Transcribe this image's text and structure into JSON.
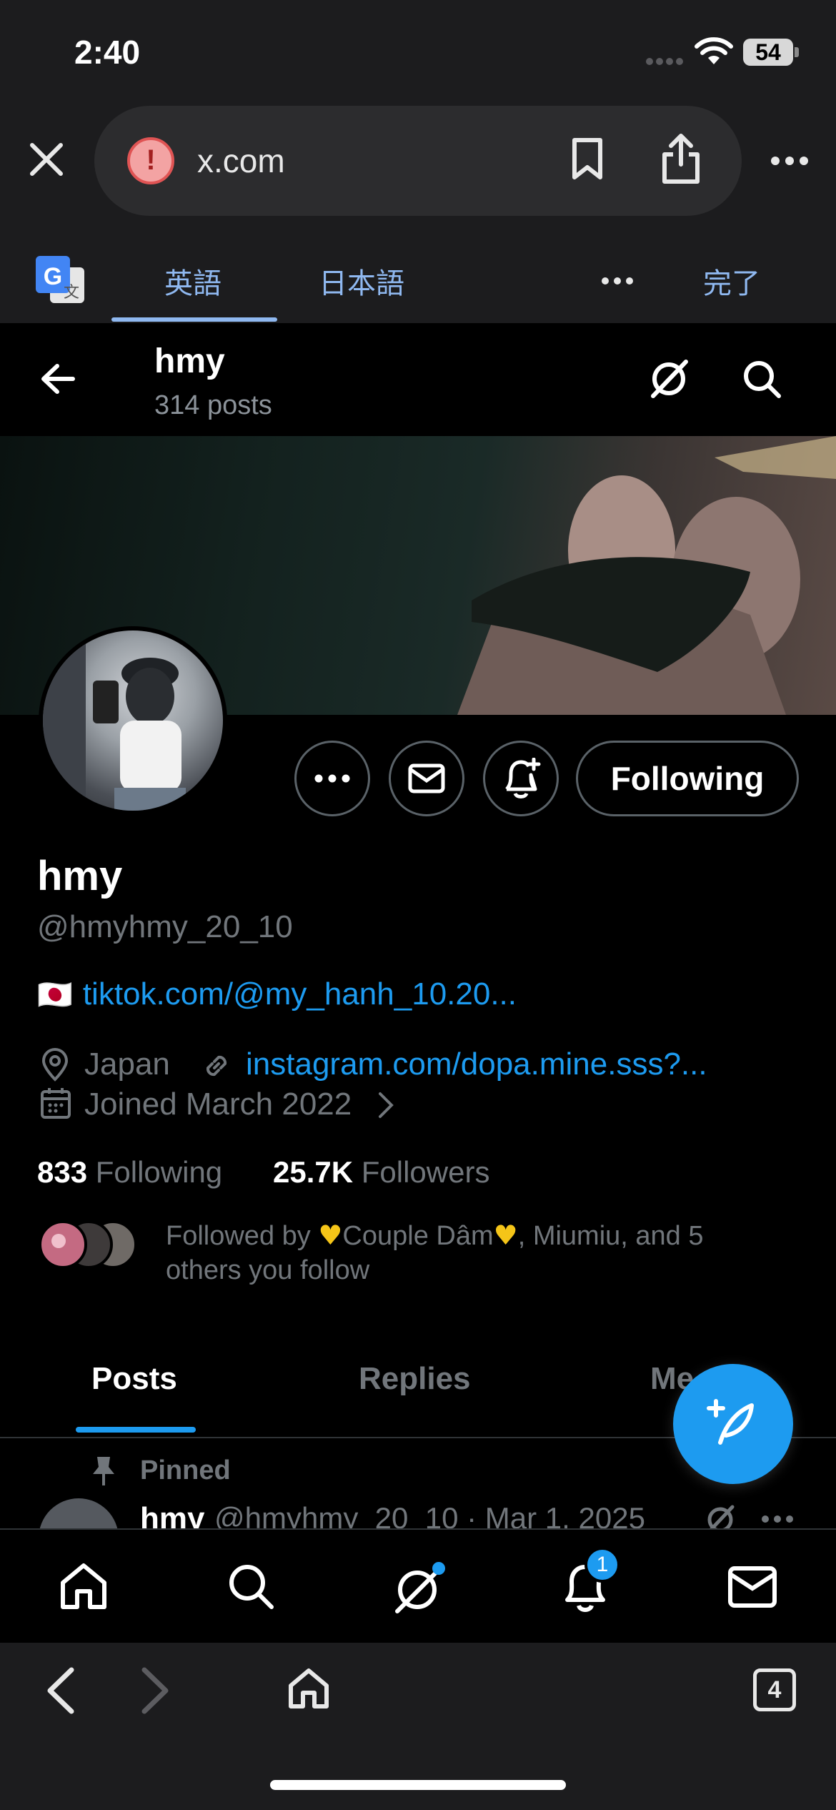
{
  "status_bar": {
    "time": "2:40",
    "battery": "54"
  },
  "browser": {
    "url": "x.com"
  },
  "translate_bar": {
    "lang_source": "英語",
    "lang_target": "日本語",
    "done": "完了"
  },
  "header": {
    "name": "hmy",
    "posts_count": "314 posts"
  },
  "profile": {
    "display_name": "hmy",
    "handle": "@hmyhmy_20_10",
    "bio_flag": "🇯🇵",
    "bio_link": "tiktok.com/@my_hanh_10.20...",
    "location": "Japan",
    "website": "instagram.com/dopa.mine.sss?...",
    "joined": "Joined March 2022",
    "following_count": "833",
    "following_label": "Following",
    "followers_count": "25.7K",
    "followers_label": "Followers",
    "followed_by_prefix": "Followed by ",
    "followed_by_name1": "Couple Dâm",
    "followed_by_rest": ", Miumiu, and 5",
    "followed_by_line2": "others you follow",
    "follow_button": "Following"
  },
  "tabs": [
    {
      "label": "Posts",
      "active": true
    },
    {
      "label": "Replies",
      "active": false
    },
    {
      "label": "Me",
      "active": false
    }
  ],
  "pinned": {
    "label": "Pinned",
    "name": "hmy",
    "meta": "@hmyhmy_20_10 · Mar 1, 2025"
  },
  "bottom_nav": {
    "notifications_badge": "1"
  },
  "browser_toolbar": {
    "tab_count": "4"
  },
  "colors": {
    "accent": "#1d9bf0",
    "background": "#000000",
    "chrome": "#1c1c1e"
  }
}
